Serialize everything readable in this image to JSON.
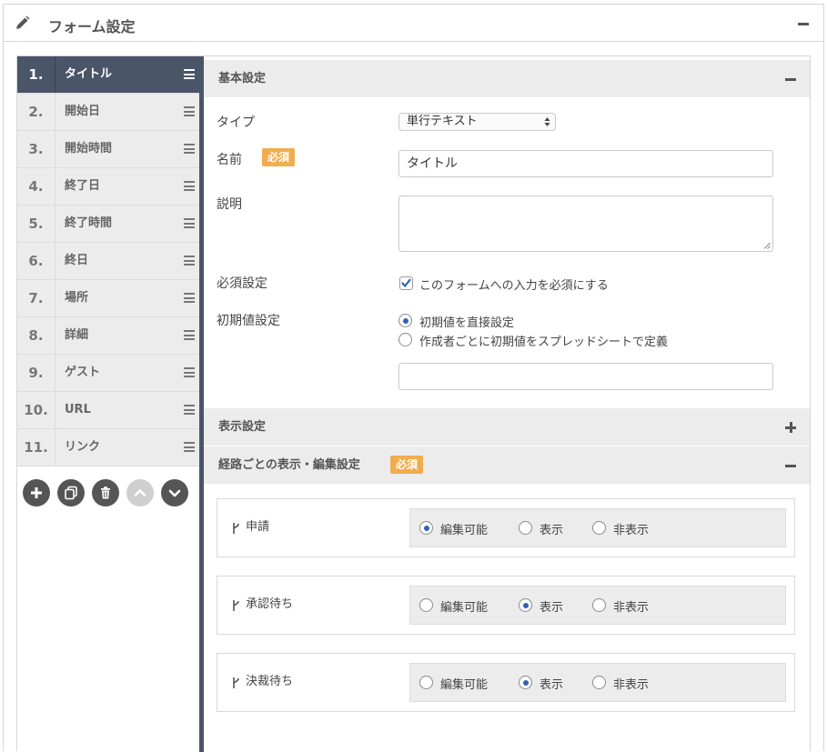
{
  "header": {
    "title": "フォーム設定"
  },
  "items": [
    {
      "num": "1.",
      "label": "タイトル"
    },
    {
      "num": "2.",
      "label": "開始日"
    },
    {
      "num": "3.",
      "label": "開始時間"
    },
    {
      "num": "4.",
      "label": "終了日"
    },
    {
      "num": "5.",
      "label": "終了時間"
    },
    {
      "num": "6.",
      "label": "終日"
    },
    {
      "num": "7.",
      "label": "場所"
    },
    {
      "num": "8.",
      "label": "詳細"
    },
    {
      "num": "9.",
      "label": "ゲスト"
    },
    {
      "num": "10.",
      "label": "URL"
    },
    {
      "num": "11.",
      "label": "リンク"
    }
  ],
  "tools": [
    "add-icon",
    "copy-icon",
    "trash-icon",
    "chevron-up-icon",
    "chevron-down-icon"
  ],
  "basic": {
    "title": "基本設定",
    "type_label": "タイプ",
    "type_value": "単行テキスト",
    "name_label": "名前",
    "required_badge": "必須",
    "name_value": "タイトル",
    "desc_label": "説明",
    "required_label": "必須設定",
    "required_checkbox": "このフォームへの入力を必須にする",
    "default_label": "初期値設定",
    "default_opt1": "初期値を直接設定",
    "default_opt2": "作成者ごとに初期値をスプレッドシートで定義"
  },
  "display": {
    "title": "表示設定"
  },
  "route": {
    "title": "経路ごとの表示・編集設定",
    "badge": "必須",
    "opt_edit": "編集可能",
    "opt_show": "表示",
    "opt_hide": "非表示",
    "rows": [
      {
        "name": "申請",
        "selected": "edit"
      },
      {
        "name": "承認待ち",
        "selected": "show"
      },
      {
        "name": "決裁待ち",
        "selected": "show"
      }
    ]
  },
  "colors": {
    "active": "#4a5568",
    "badge": "#f0ad4e",
    "radio": "#2e64b8"
  }
}
